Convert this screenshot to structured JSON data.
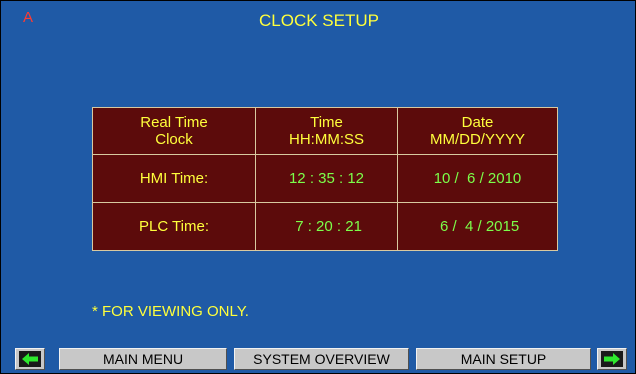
{
  "header": {
    "alarm_indicator": "A",
    "title": "CLOCK SETUP"
  },
  "clock_table": {
    "headers": [
      {
        "line1": "Real Time",
        "line2": "Clock"
      },
      {
        "line1": "Time",
        "line2": "HH:MM:SS"
      },
      {
        "line1": "Date",
        "line2": "MM/DD/YYYY"
      }
    ],
    "rows": [
      {
        "label": "HMI Time:",
        "time": "12 : 35 : 12",
        "date": "10 /  6 / 2010"
      },
      {
        "label": "PLC Time:",
        "time": " 7 : 20 : 21",
        "date": " 6 /  4 / 2015"
      }
    ]
  },
  "note": "* FOR VIEWING ONLY.",
  "nav": {
    "prev_icon": "left-arrow-icon",
    "next_icon": "right-arrow-icon",
    "main_menu": "MAIN MENU",
    "system_overview": "SYSTEM OVERVIEW",
    "main_setup": "MAIN SETUP",
    "arrow_color": "#2ee82e"
  },
  "colors": {
    "background": "#1f5aa6",
    "table_fill": "#5c0b0b",
    "label_text": "#ffff3c",
    "value_text": "#7cff4a",
    "alarm": "#ff3b30"
  }
}
